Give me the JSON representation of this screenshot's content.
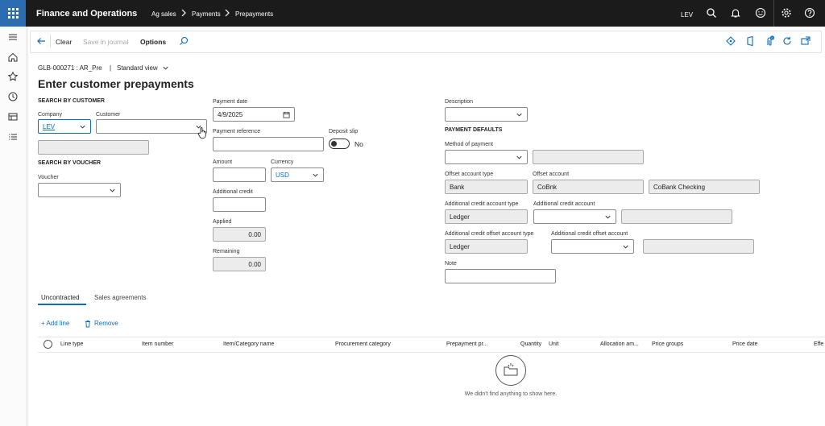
{
  "topbar": {
    "app_title": "Finance and Operations",
    "breadcrumbs": [
      "Ag sales",
      "Payments",
      "Prepayments"
    ],
    "company": "LEV",
    "icons": [
      "search-icon",
      "bell-icon",
      "smiley-icon",
      "gear-icon",
      "help-icon"
    ]
  },
  "actionbar": {
    "clear_label": "Clear",
    "save_label": "Save in journal",
    "options_label": "Options"
  },
  "page": {
    "record": "GLB-000271 : AR_Pre",
    "separator": "|",
    "view": "Standard view",
    "title": "Enter customer prepayments"
  },
  "search_customer": {
    "header": "SEARCH BY CUSTOMER",
    "company_label": "Company",
    "company_value": "LEV",
    "customer_label": "Customer",
    "customer_value": "",
    "customer_name": ""
  },
  "search_voucher": {
    "header": "SEARCH BY VOUCHER",
    "voucher_label": "Voucher",
    "voucher_value": ""
  },
  "payment": {
    "date_label": "Payment date",
    "date_value": "4/9/2025",
    "reference_label": "Payment reference",
    "reference_value": "",
    "deposit_label": "Deposit slip",
    "deposit_value": "No",
    "amount_label": "Amount",
    "amount_value": "",
    "currency_label": "Currency",
    "currency_value": "USD",
    "additional_credit_label": "Additional credit",
    "additional_credit_value": "",
    "applied_label": "Applied",
    "applied_value": "0.00",
    "remaining_label": "Remaining",
    "remaining_value": "0.00"
  },
  "defaults": {
    "description_label": "Description",
    "description_value": "",
    "header": "PAYMENT DEFAULTS",
    "method_label": "Method of payment",
    "method_value": "",
    "method_desc": "",
    "offset_type_label": "Offset account type",
    "offset_type_value": "Bank",
    "offset_account_label": "Offset account",
    "offset_account_value": "CoBnk",
    "offset_account_name": "CoBank Checking",
    "acct_type_label": "Additional credit account type",
    "acct_type_value": "Ledger",
    "acct_label": "Additional credit account",
    "acct_value": "",
    "acct_desc": "",
    "offset_acct_type_label": "Additional credit offset account type",
    "offset_acct_type_value": "Ledger",
    "offset_acct_label": "Additional credit offset account",
    "offset_acct_value": "",
    "offset_acct_desc": "",
    "note_label": "Note",
    "note_value": ""
  },
  "tabs": [
    "Uncontracted",
    "Sales agreements"
  ],
  "grid": {
    "add_line": "Add line",
    "remove": "Remove",
    "columns": [
      "Line type",
      "Item number",
      "Item/Category name",
      "Procurement category",
      "Prepayment pr...",
      "Quantity",
      "Unit",
      "Allocation am...",
      "Price groups",
      "Price date",
      "Effe"
    ],
    "empty_text": "We didn't find anything to show here."
  },
  "colors": {
    "accent": "#0f6cbd",
    "topbar": "#1b1b1b",
    "app_launcher": "#2b6cb3"
  }
}
